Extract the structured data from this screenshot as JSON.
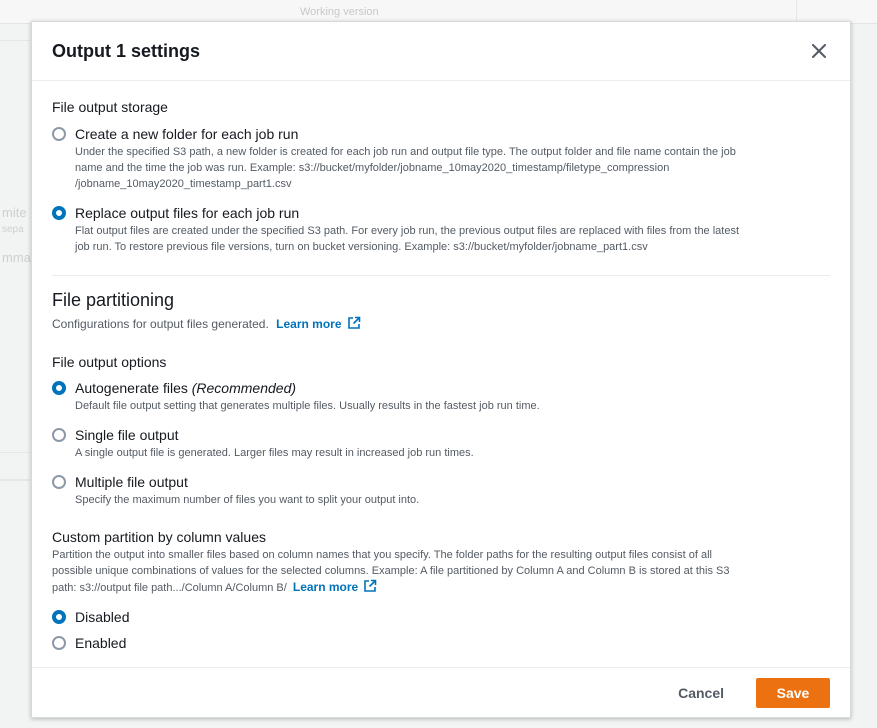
{
  "background": {
    "working_version": "Working version",
    "frag_1": "mite",
    "frag_2": "sepa",
    "frag_3": "mma"
  },
  "modal": {
    "title": "Output 1 settings",
    "file_output_storage": {
      "label": "File output storage",
      "options": [
        {
          "label": "Create a new folder for each job run",
          "desc_1": "Under the specified S3 path, a new folder is created for each job run and output file type. The output folder and file name contain the job",
          "desc_2": "name and the time the job was run. Example: s3://bucket/myfolder/jobname_10may2020_timestamp/filetype_compression",
          "desc_3": "/jobname_10may2020_timestamp_part1.csv",
          "checked": false
        },
        {
          "label": "Replace output files for each job run",
          "desc_1": "Flat output files are created under the specified S3 path. For every job run, the previous output files are replaced with files from the latest",
          "desc_2": "job run. To restore previous file versions, turn on bucket versioning. Example: s3://bucket/myfolder/jobname_part1.csv",
          "checked": true
        }
      ]
    },
    "file_partitioning": {
      "heading": "File partitioning",
      "desc": "Configurations for output files generated.",
      "learn_more": "Learn more"
    },
    "file_output_options": {
      "label": "File output options",
      "options": [
        {
          "label": "Autogenerate files",
          "label_suffix": "(Recommended)",
          "desc": "Default file output setting that generates multiple files. Usually results in the fastest job run time.",
          "checked": true
        },
        {
          "label": "Single file output",
          "desc": "A single output file is generated. Larger files may result in increased job run times.",
          "checked": false
        },
        {
          "label": "Multiple file output",
          "desc": "Specify the maximum number of files you want to split your output into.",
          "checked": false
        }
      ]
    },
    "custom_partition": {
      "label": "Custom partition by column values",
      "desc_1": "Partition the output into smaller files based on column names that you specify. The folder paths for the resulting output files consist of all",
      "desc_2": "possible unique combinations of values for the selected columns. Example: A file partitioned by Column A and Column B is stored at this S3",
      "desc_3": "path: s3://output file path.../Column A/Column B/",
      "learn_more": "Learn more",
      "options": [
        {
          "label": "Disabled",
          "checked": true
        },
        {
          "label": "Enabled",
          "checked": false
        }
      ]
    },
    "footer": {
      "cancel": "Cancel",
      "save": "Save"
    }
  },
  "colors": {
    "accent": "#0073bb",
    "primary_button": "#ec7211"
  }
}
